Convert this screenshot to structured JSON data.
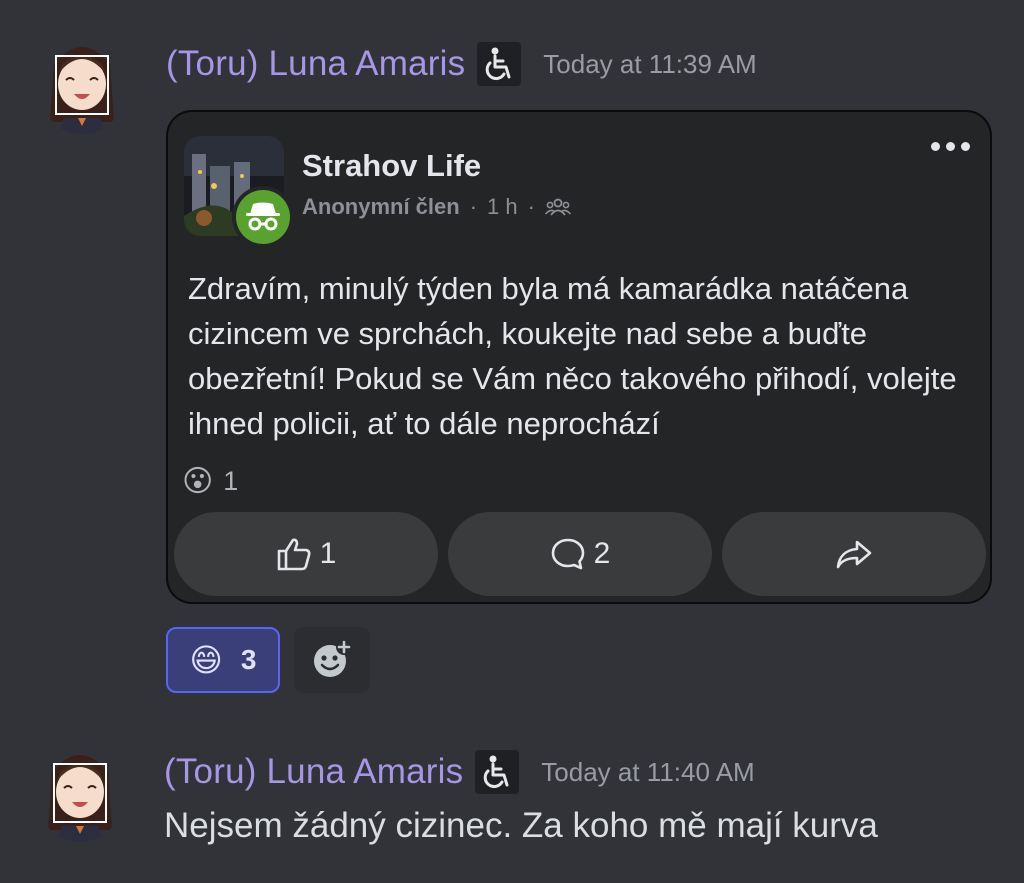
{
  "messages": [
    {
      "username": "(Toru) Luna Amaris",
      "role_icon": "wheelchair-icon",
      "timestamp": "Today at 11:39 AM",
      "embed": {
        "group_name": "Strahov Life",
        "author": "Anonymní člen",
        "time_ago": "1 h",
        "audience_icon": "group-icon",
        "body": "Zdravím, minulý týden byla má kamarádka natáčena cizincem ve sprchách, koukejte nad sebe a buďte obezřetní! Pokud se Vám něco takového přihodí, volejte ihned policii, ať to dále neprochází",
        "reaction_emoji": "😮",
        "reaction_count": "1",
        "like_count": "1",
        "comment_count": "2"
      },
      "reactions": [
        {
          "emoji": "😄",
          "count": "3"
        }
      ]
    },
    {
      "username": "(Toru) Luna Amaris",
      "role_icon": "wheelchair-icon",
      "timestamp": "Today at 11:40 AM",
      "text": "Nejsem žádný cizinec. Za koho mě mají kurva"
    }
  ],
  "colors": {
    "background": "#313338",
    "username": "#a795e6",
    "reaction_active_bg": "#3b3f79",
    "reaction_active_border": "#5865f2",
    "anon_badge": "#5aa230"
  }
}
